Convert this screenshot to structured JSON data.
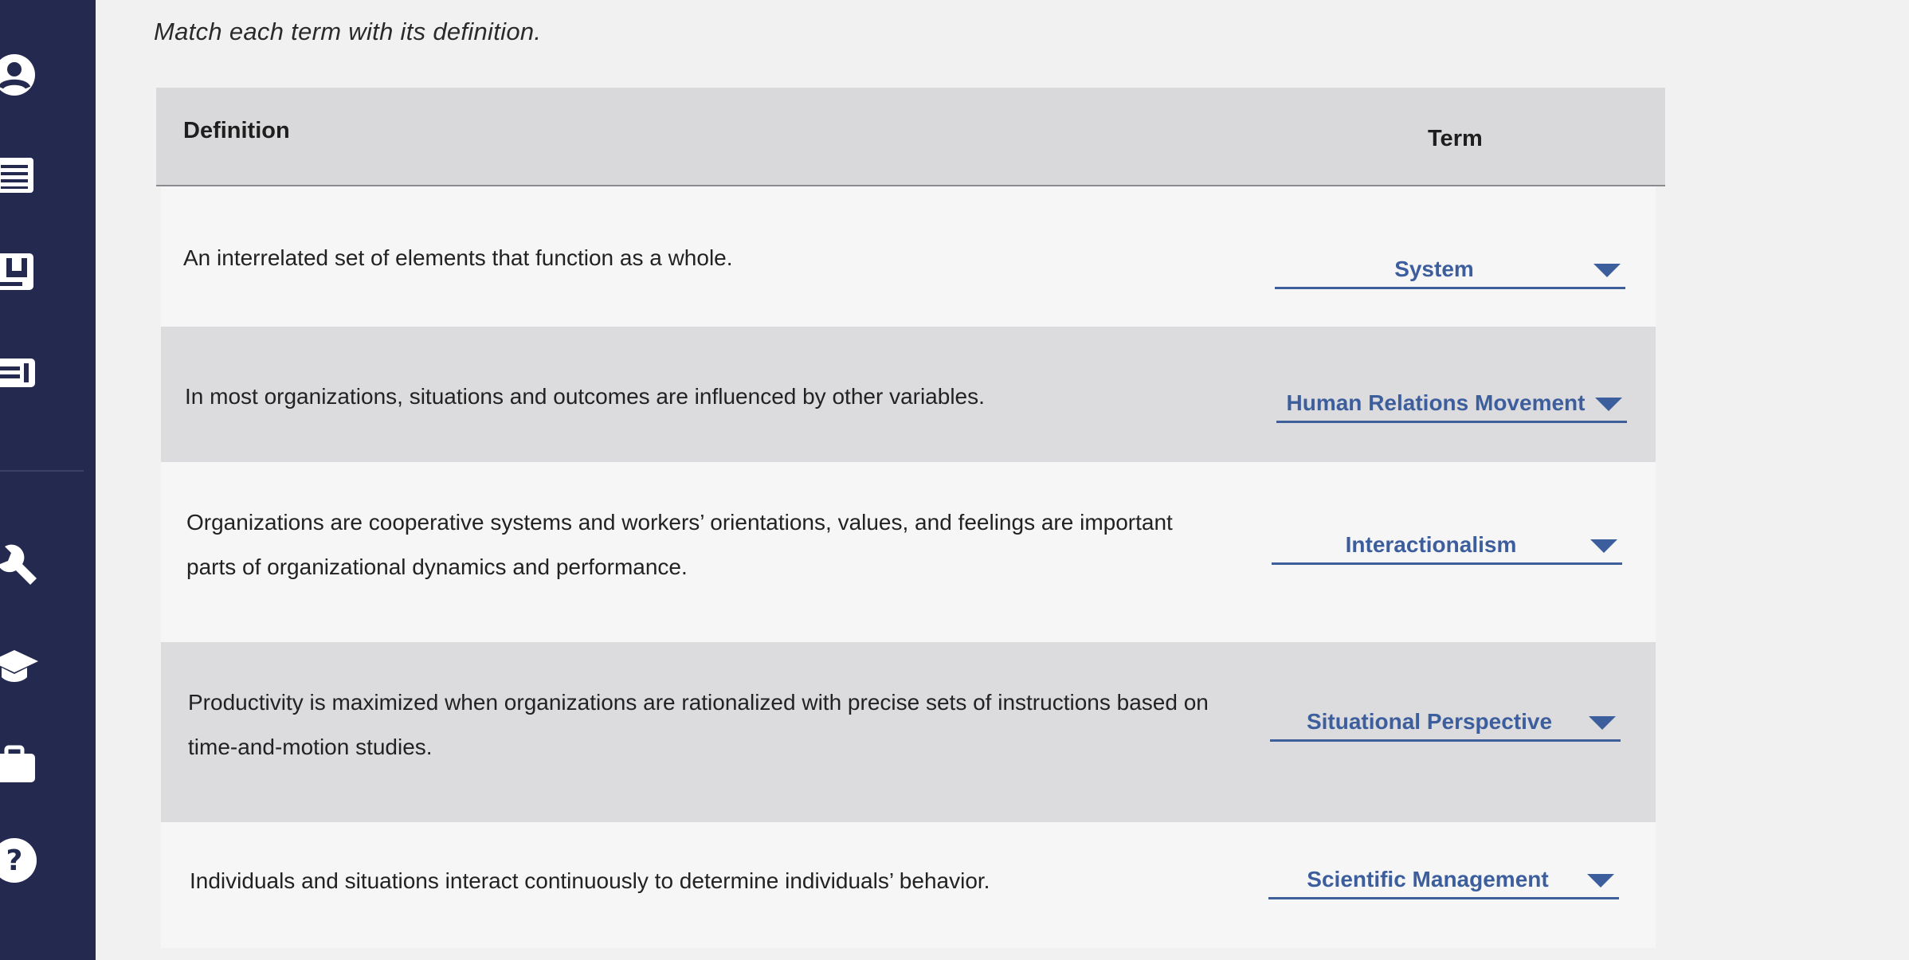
{
  "instructions": "Match each term with its definition.",
  "table": {
    "headers": {
      "definition": "Definition",
      "term": "Term"
    },
    "rows": [
      {
        "definition": "An interrelated set of elements that function as a whole.",
        "term": "System"
      },
      {
        "definition": "In most organizations, situations and outcomes are influenced by other variables.",
        "term": "Human Relations Movement"
      },
      {
        "definition_lines": [
          "Organizations are cooperative systems and workers’ orientations, values, and feelings are important",
          "parts of organizational dynamics and performance."
        ],
        "term": "Interactionalism"
      },
      {
        "definition_lines": [
          "Productivity is maximized when organizations are rationalized with precise sets of instructions based on",
          "time-and-motion studies."
        ],
        "term": "Situational Perspective"
      },
      {
        "definition": "Individuals and situations interact continuously to determine individuals’ behavior.",
        "term": "Scientific Management"
      }
    ]
  },
  "sidebar": {
    "icons": [
      "user-icon",
      "list-icon",
      "book-icon",
      "card-icon",
      "wrench-icon",
      "graduation-cap-icon",
      "briefcase-icon",
      "help-icon"
    ]
  },
  "colors": {
    "sidebar": "#242a4f",
    "accent": "#3d5e9d",
    "header_bg": "#d9d9db",
    "row_light": "#f6f6f7",
    "row_dark": "#dcdcde"
  }
}
